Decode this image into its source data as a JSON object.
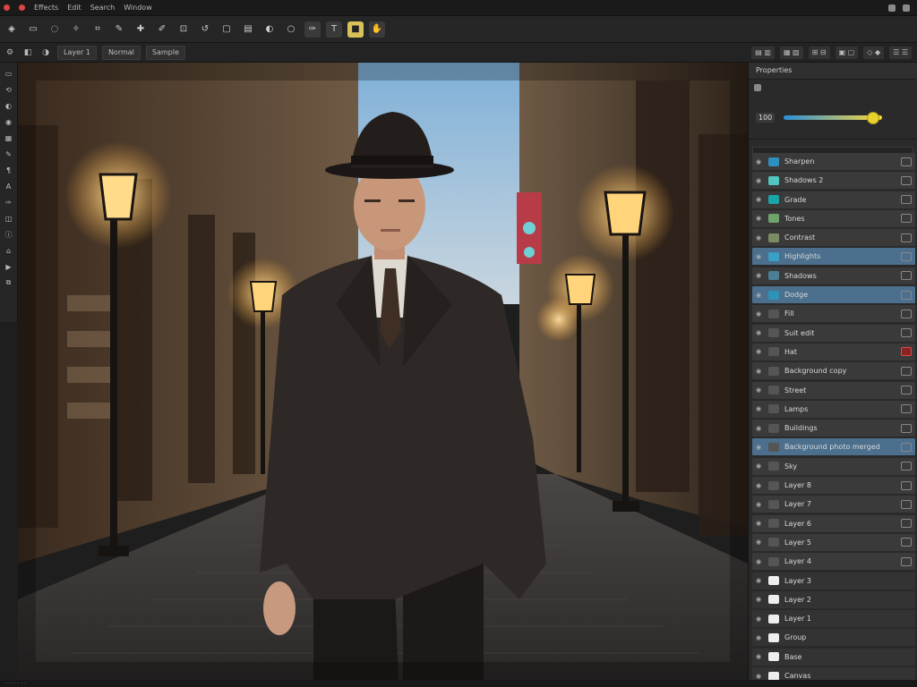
{
  "menubar": {
    "items": [
      "Effects",
      "Edit",
      "Search",
      "Window"
    ]
  },
  "options": {
    "fields": [
      "Layer 1",
      "Normal",
      "Sample"
    ]
  },
  "panel": {
    "tab_label": "Properties",
    "slider_label": "100",
    "slider_value": 0.9,
    "layers": [
      {
        "name": "Sharpen",
        "thumb": "#2f8fbf",
        "state": "normal"
      },
      {
        "name": "Shadows 2",
        "thumb": "#53c5c1",
        "state": "normal"
      },
      {
        "name": "Grade",
        "thumb": "#1aa6a9",
        "state": "normal"
      },
      {
        "name": "Tones",
        "thumb": "#6fa56b",
        "state": "normal"
      },
      {
        "name": "Contrast",
        "thumb": "#7a8c63",
        "state": "normal"
      },
      {
        "name": "Highlights",
        "thumb": "#3aa0c6",
        "state": "selected"
      },
      {
        "name": "Shadows",
        "thumb": "#4b7f97",
        "state": "normal"
      },
      {
        "name": "Dodge",
        "thumb": "#2e93b6",
        "state": "selected"
      },
      {
        "name": "Fill",
        "thumb": "#555",
        "state": "normal"
      },
      {
        "name": "Suit edit",
        "thumb": "#555",
        "state": "normal"
      },
      {
        "name": "Hat",
        "thumb": "#555",
        "state": "flag-red"
      },
      {
        "name": "Background copy",
        "thumb": "#555",
        "state": "normal"
      },
      {
        "name": "Street",
        "thumb": "#555",
        "state": "normal"
      },
      {
        "name": "Lamps",
        "thumb": "#555",
        "state": "normal"
      },
      {
        "name": "Buildings",
        "thumb": "#555",
        "state": "normal"
      },
      {
        "name": "Background photo merged",
        "thumb": "#555",
        "state": "selected"
      },
      {
        "name": "Sky",
        "thumb": "#555",
        "state": "normal"
      },
      {
        "name": "Layer 8",
        "thumb": "#555",
        "state": "normal"
      },
      {
        "name": "Layer 7",
        "thumb": "#555",
        "state": "normal"
      },
      {
        "name": "Layer 6",
        "thumb": "#555",
        "state": "normal"
      },
      {
        "name": "Layer 5",
        "thumb": "#555",
        "state": "normal"
      },
      {
        "name": "Layer 4",
        "thumb": "#555",
        "state": "normal"
      },
      {
        "name": "Layer 3",
        "thumb": "#eee",
        "state": "dim"
      },
      {
        "name": "Layer 2",
        "thumb": "#eee",
        "state": "dim"
      },
      {
        "name": "Layer 1",
        "thumb": "#eee",
        "state": "dim"
      },
      {
        "name": "Group",
        "thumb": "#eee",
        "state": "dim"
      },
      {
        "name": "Base",
        "thumb": "#eee",
        "state": "dim"
      },
      {
        "name": "Canvas",
        "thumb": "#eee",
        "state": "dim"
      }
    ]
  }
}
